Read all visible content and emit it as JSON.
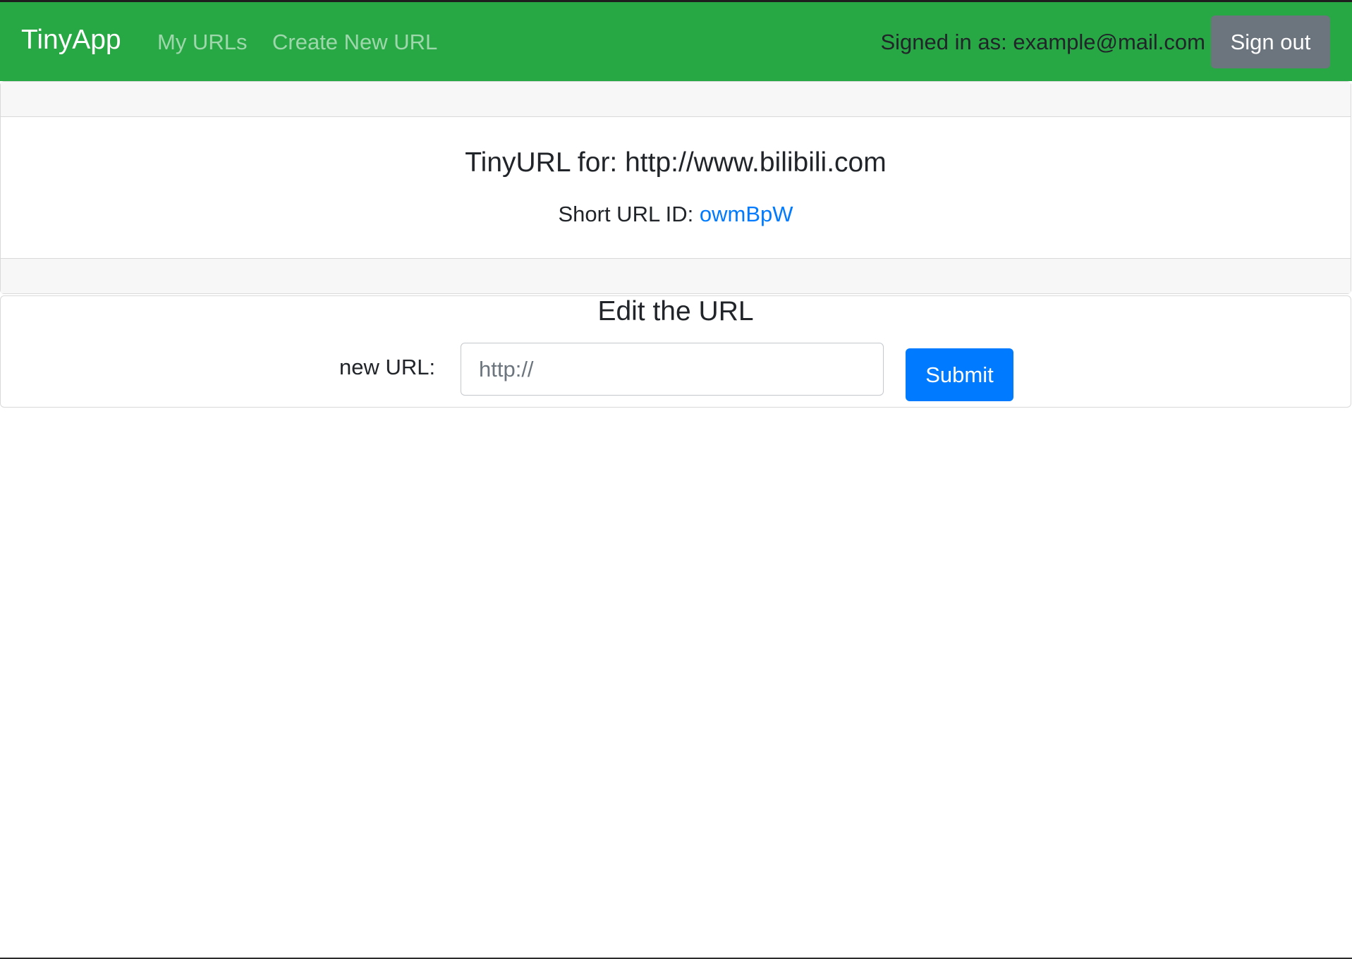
{
  "navbar": {
    "brand": "TinyApp",
    "links": [
      "My URLs",
      "Create New URL"
    ],
    "signed_in_text": "Signed in as: example@mail.com",
    "signout_label": "Sign out",
    "colors": {
      "background": "#28a745",
      "signout_button": "#6c757d"
    }
  },
  "url_card": {
    "title": "TinyURL for: http://www.bilibili.com",
    "short_label": "Short URL ID: ",
    "short_id": "owmBpW",
    "link_color": "#007bff"
  },
  "edit_card": {
    "title": "Edit the URL",
    "field_label": "new URL:",
    "input_value": "",
    "input_placeholder": "http://",
    "submit_label": "Submit",
    "submit_color": "#007bff"
  }
}
